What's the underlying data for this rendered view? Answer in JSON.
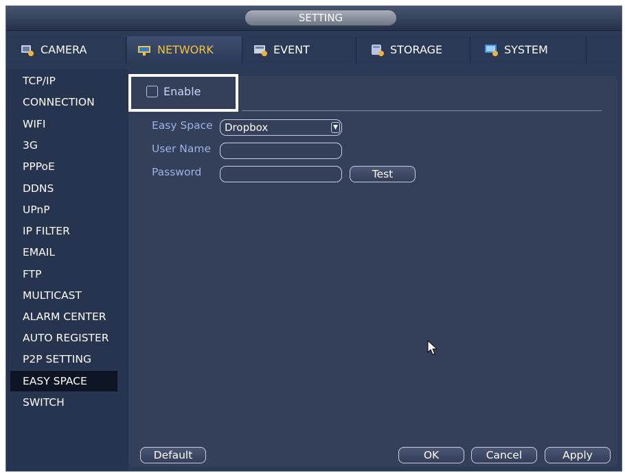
{
  "titlebar": {
    "title": "SETTING"
  },
  "tabs": [
    {
      "label": "CAMERA",
      "icon": "camera-icon",
      "active": false
    },
    {
      "label": "NETWORK",
      "icon": "network-icon",
      "active": true
    },
    {
      "label": "EVENT",
      "icon": "event-icon",
      "active": false
    },
    {
      "label": "STORAGE",
      "icon": "storage-icon",
      "active": false
    },
    {
      "label": "SYSTEM",
      "icon": "system-icon",
      "active": false
    }
  ],
  "sidebar": {
    "items": [
      {
        "label": "TCP/IP"
      },
      {
        "label": "CONNECTION"
      },
      {
        "label": "WIFI"
      },
      {
        "label": "3G"
      },
      {
        "label": "PPPoE"
      },
      {
        "label": "DDNS"
      },
      {
        "label": "UPnP"
      },
      {
        "label": "IP FILTER"
      },
      {
        "label": "EMAIL"
      },
      {
        "label": "FTP"
      },
      {
        "label": "MULTICAST"
      },
      {
        "label": "ALARM CENTER"
      },
      {
        "label": "AUTO REGISTER"
      },
      {
        "label": "P2P SETTING"
      },
      {
        "label": "EASY SPACE"
      },
      {
        "label": "SWITCH"
      }
    ],
    "active_index": 14
  },
  "form": {
    "enable_label": "Enable",
    "enable_checked": false,
    "easy_space_label": "Easy Space",
    "easy_space_value": "Dropbox",
    "user_name_label": "User Name",
    "user_name_value": "",
    "password_label": "Password",
    "password_value": "",
    "test_button": "Test"
  },
  "footer": {
    "default_button": "Default",
    "ok_button": "OK",
    "cancel_button": "Cancel",
    "apply_button": "Apply"
  },
  "colors": {
    "background": "#2b3a55",
    "panel": "#343f5a",
    "active_tab_text": "#f6c33c",
    "form_label": "#9eb2e5",
    "sidebar_active": "#0d1424"
  }
}
